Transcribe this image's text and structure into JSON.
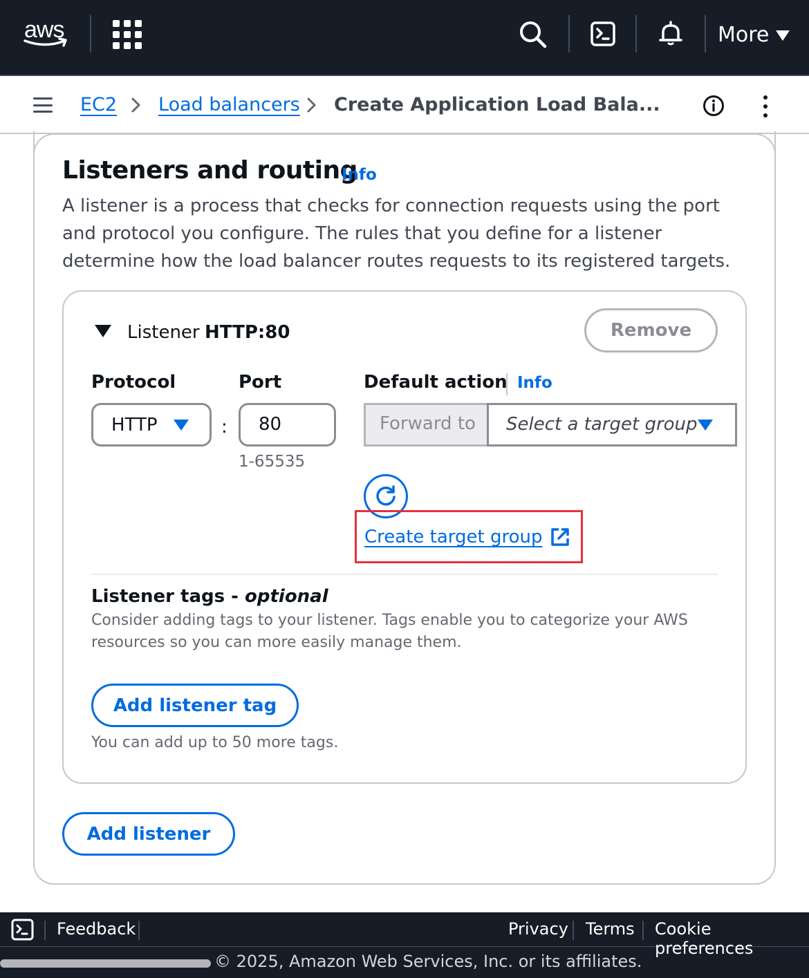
{
  "topbar": {
    "logo_text": "aws",
    "more_label": "More"
  },
  "breadcrumb": {
    "items": [
      "EC2",
      "Load balancers"
    ],
    "current": "Create Application Load Bala..."
  },
  "section": {
    "title": "Listeners and routing",
    "info": "Info",
    "description": "A listener is a process that checks for connection requests using the port and protocol you configure. The rules that you define for a listener determine how the load balancer routes requests to its registered targets."
  },
  "listener": {
    "label": "Listener",
    "value": "HTTP:80",
    "remove_label": "Remove",
    "protocol_label": "Protocol",
    "protocol_value": "HTTP",
    "port_label": "Port",
    "port_value": "80",
    "port_hint": "1-65535",
    "default_action_label": "Default action",
    "default_action_info": "Info",
    "forward_to": "Forward to",
    "target_group_placeholder": "Select a target group",
    "create_target_group": "Create target group"
  },
  "tags": {
    "title": "Listener tags - ",
    "title_optional": "optional",
    "description": "Consider adding tags to your listener. Tags enable you to categorize your AWS resources so you can more easily manage them.",
    "add_label": "Add listener tag",
    "hint": "You can add up to 50 more tags."
  },
  "add_listener_label": "Add listener",
  "footer": {
    "feedback": "Feedback",
    "privacy": "Privacy",
    "terms": "Terms",
    "cookie": "Cookie preferences",
    "copyright": "© 2025, Amazon Web Services, Inc. or its affiliates."
  },
  "colors": {
    "nav_bg": "#161d26",
    "link": "#006ce0",
    "highlight": "#e5303e"
  }
}
